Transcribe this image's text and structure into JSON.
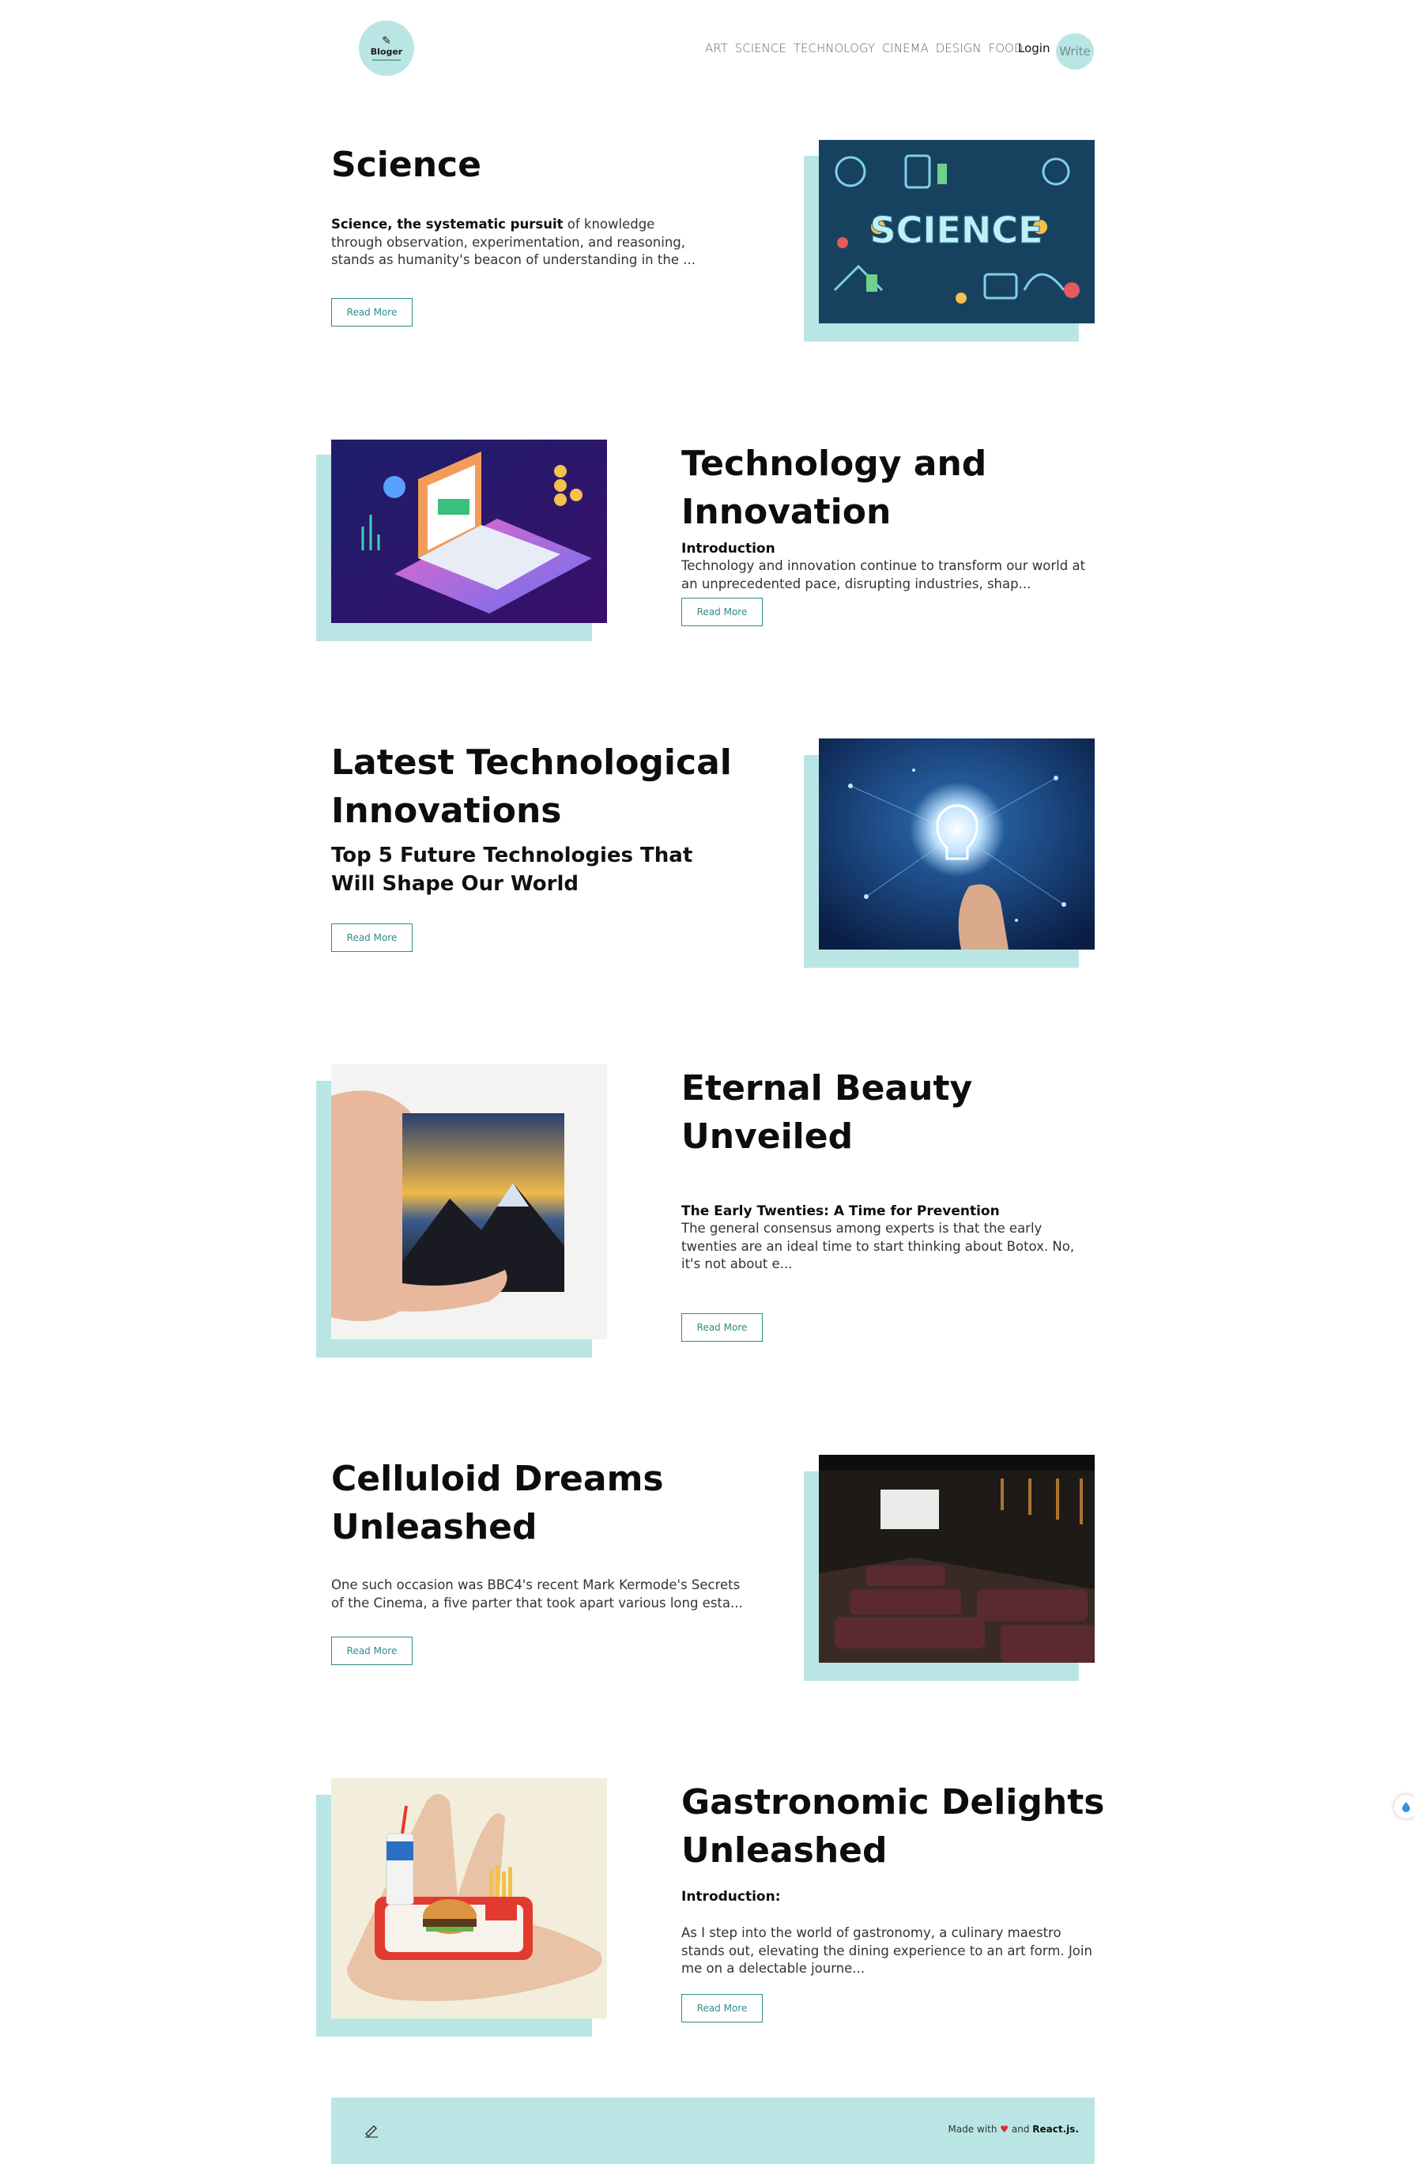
{
  "brand": {
    "name": "Bloger"
  },
  "nav": {
    "links": [
      "ART",
      "SCIENCE",
      "TECHNOLOGY",
      "CINEMA",
      "DESIGN",
      "FOOD"
    ],
    "login": "Login",
    "write": "Write"
  },
  "posts": [
    {
      "title": "Science",
      "desc_bold": "Science, the systematic pursuit",
      "desc_rest": " of knowledge through observation, experimentation, and reasoning, stands as humanity's beacon of understanding in the ...",
      "button": "Read More",
      "image": "science-doodle-illustration"
    },
    {
      "title": "Technology and Innovation",
      "subtitle": "Introduction",
      "desc": "Technology and innovation continue to transform our world at an unprecedented pace, disrupting industries, shap...",
      "button": "Read More",
      "image": "isometric-laptop-illustration"
    },
    {
      "title": "Latest Technological Innovations",
      "subtitle": "Top 5 Future Technologies That Will Shape Our World",
      "button": "Read More",
      "image": "glowing-lightbulb-network"
    },
    {
      "title": "Eternal Beauty Unveiled",
      "subtitle": "The Early Twenties: A Time for Prevention",
      "desc": "The general consensus among experts is that the early twenties are an ideal time to start thinking about Botox. No, it's not about e...",
      "button": "Read More",
      "image": "hand-holding-mountain-painting"
    },
    {
      "title": "Celluloid Dreams Unleashed",
      "desc": "One such occasion was BBC4's recent Mark Kermode's Secrets of the Cinema, a five parter that took apart various long esta...",
      "button": "Read More",
      "image": "home-cinema-room"
    },
    {
      "title": "Gastronomic Delights Unleashed",
      "subtitle": "Introduction:",
      "desc": "As I step into the world of gastronomy, a culinary maestro stands out, elevating the dining experience to an art form. Join me on a delectable journe...",
      "button": "Read More",
      "image": "miniature-fastfood-tray-on-hand"
    }
  ],
  "footer": {
    "made_with": "Made with",
    "and": "and",
    "tech": "React.js."
  },
  "colors": {
    "accent": "#b9e6e4",
    "button": "#2f8c89",
    "heart": "#e0262e"
  }
}
